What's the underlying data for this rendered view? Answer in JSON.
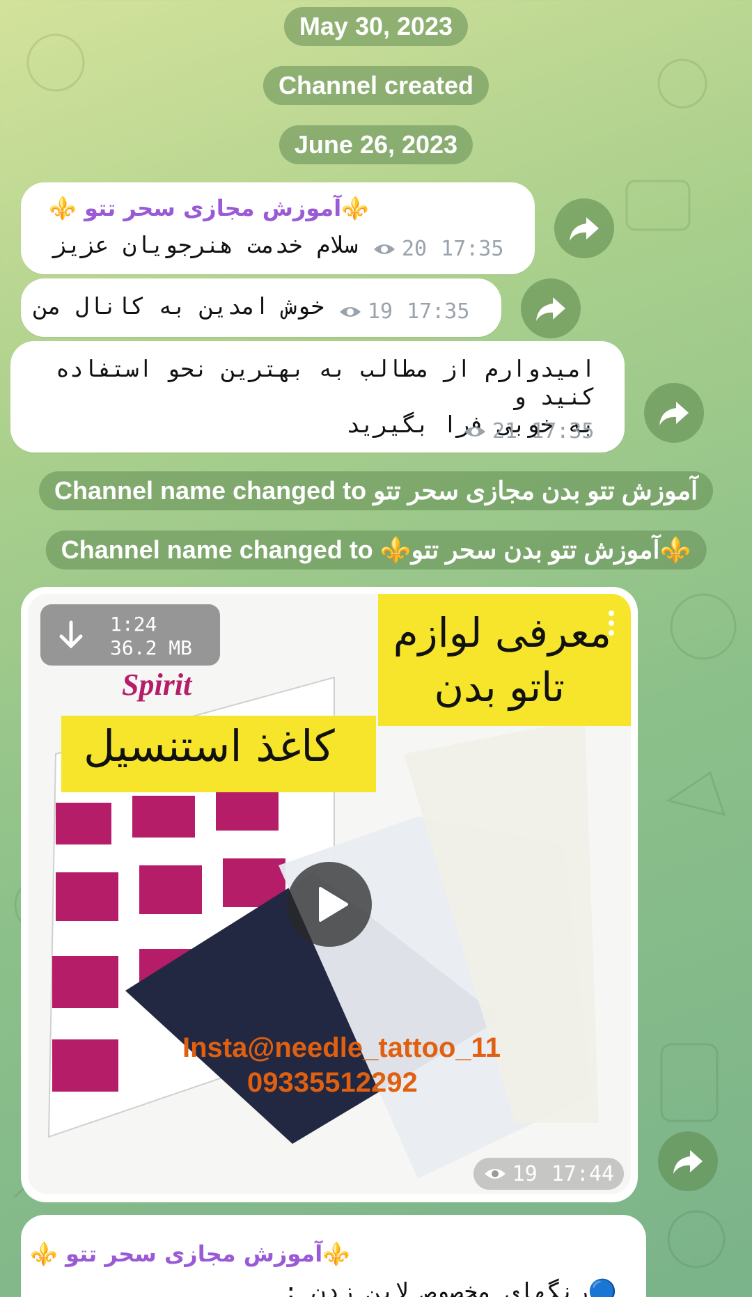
{
  "service": {
    "date1": "May 30, 2023",
    "created": "Channel created",
    "date2": "June 26, 2023",
    "rename1_prefix": "Channel name changed to",
    "rename1_name": "آموزش تتو بدن مجازی سحر تتو",
    "rename2_prefix": "Channel name changed to",
    "rename2_name": "⚜️آموزش تتو بدن سحر تتو⚜️"
  },
  "channel": {
    "author": "⚜️آموزش مجازی سحر تتو ⚜️",
    "author_color": "#9a5ad6"
  },
  "messages": [
    {
      "text": "سلام خدمت هنرجویان عزیز",
      "views": "20",
      "time": "17:35"
    },
    {
      "text": "خوش امدین به کانال من",
      "views": "19",
      "time": "17:35"
    },
    {
      "text": "امیدوارم از مطالب به بهترین نحو استفاده کنید و\nبه خوبی فرا بگیرید",
      "views": "21",
      "time": "17:35"
    }
  ],
  "video": {
    "duration": "1:24",
    "size": "36.2 MB",
    "headline_line1": "معرفی لوازم",
    "headline_line2": "تاتو بدن",
    "label": "کاغذ استنسیل",
    "brand": "Spirit",
    "insta": "Insta@needle_tattoo_11",
    "phone": "09335512292",
    "views": "19",
    "time": "17:44"
  },
  "last_message": {
    "author": "⚜️آموزش مجازی سحر تتو ⚜️",
    "text": "🔵رنگهای مخصوص لاین زدن :"
  },
  "icons": {
    "share": "share-arrow-icon",
    "views": "eye-icon",
    "download": "download-arrow-icon",
    "play": "play-icon",
    "more": "kebab-menu-icon"
  },
  "colors": {
    "accent": "#9a5ad6",
    "meta_grey": "#9aa3ab",
    "pill_bg": "#628c54"
  }
}
